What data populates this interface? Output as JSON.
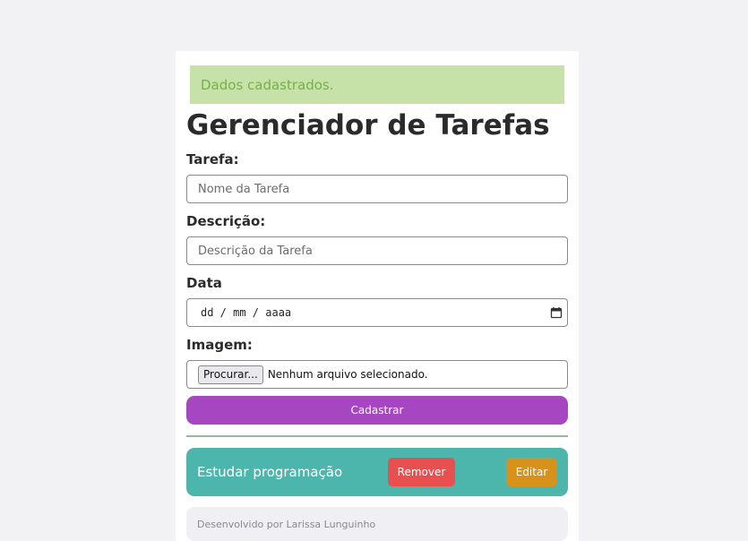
{
  "alert": {
    "message": "Dados cadastrados."
  },
  "page": {
    "title": "Gerenciador de Tarefas"
  },
  "form": {
    "task_label": "Tarefa:",
    "task_placeholder": "Nome da Tarefa",
    "description_label": "Descrição:",
    "description_placeholder": "Descrição da Tarefa",
    "date_label": "Data",
    "date_value": "dd / mm / aaaa",
    "image_label": "Imagem:",
    "file_button": "Procurar...",
    "file_status": "Nenhum arquivo selecionado.",
    "submit_label": "Cadastrar"
  },
  "tasks": [
    {
      "title": "Estudar programação",
      "remove_label": "Remover",
      "edit_label": "Editar"
    }
  ],
  "footer": {
    "text": "Desenvolvido por Larissa Lunguinho"
  },
  "colors": {
    "background": "#f2f2f5",
    "alert_bg": "#c6e2a8",
    "alert_text": "#77b04a",
    "submit": "#a646c0",
    "task_bg": "#4db6ac",
    "remove": "#e8504f",
    "edit": "#d6921a",
    "footer_bg": "#efeff4"
  },
  "icons": {
    "date_picker": "calendar-icon"
  }
}
